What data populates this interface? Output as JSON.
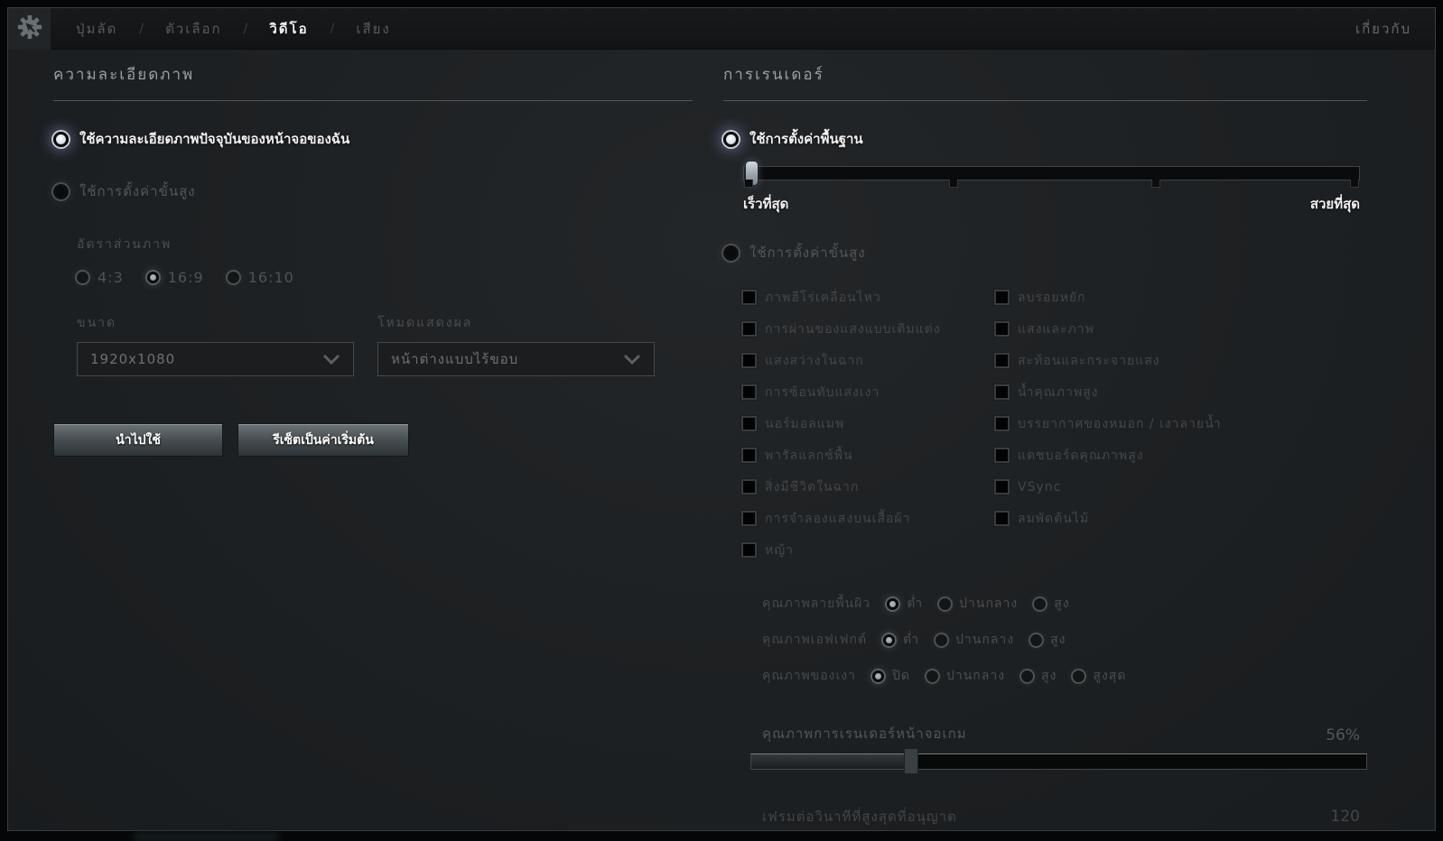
{
  "topbar": {
    "gear_icon": "gear-cursor-settings-icon",
    "separator": "/",
    "tabs": [
      {
        "label": "ปุ่มลัด",
        "active": false
      },
      {
        "label": "ตัวเลือก",
        "active": false
      },
      {
        "label": "วิดีโอ",
        "active": true
      },
      {
        "label": "เสียง",
        "active": false
      }
    ],
    "about_label": "เกี่ยวกับ"
  },
  "resolution": {
    "title": "ความละเอียดภาพ",
    "use_current": {
      "label": "ใช้ความละเอียดภาพปัจจุบันของหน้าจอของฉัน",
      "selected": true
    },
    "use_advanced": {
      "label": "ใช้การตั้งค่าขั้นสูง",
      "selected": false
    },
    "aspect": {
      "label": "อัตราส่วนภาพ",
      "options": [
        {
          "label": "4:3",
          "selected": false
        },
        {
          "label": "16:9",
          "selected": true
        },
        {
          "label": "16:10",
          "selected": false
        }
      ]
    },
    "size": {
      "label": "ขนาด",
      "value": "1920x1080"
    },
    "display_mode": {
      "label": "โหมดแสดงผล",
      "value": "หน้าต่างแบบไร้ขอบ"
    },
    "apply_label": "นำไปใช้",
    "reset_label": "รีเซ็ตเป็นค่าเริ่มต้น"
  },
  "rendering": {
    "title": "การเรนเดอร์",
    "use_basic": {
      "label": "ใช้การตั้งค่าพื้นฐาน",
      "selected": true
    },
    "basic_slider": {
      "left_label": "เร็วที่สุด",
      "right_label": "สวยที่สุด",
      "value_pct": 0,
      "ticks_pct": [
        0,
        34,
        67,
        100
      ]
    },
    "use_advanced": {
      "label": "ใช้การตั้งค่าขั้นสูง",
      "selected": false
    },
    "advanced_options": {
      "col1": [
        "ภาพฮีโร่เคลื่อนไหว",
        "การผ่านของแสงแบบเติมแต่ง",
        "แสงสว่างในฉาก",
        "การซ้อนทับแสงเงา",
        "นอร์มอลแมพ",
        "พารัลแลกซ์พื้น",
        "สิ่งมีชีวิตในฉาก",
        "การจำลองแสงบนเสื้อผ้า",
        "หญ้า"
      ],
      "col2": [
        "ลบรอยหยัก",
        "แสงและภาพ",
        "สะท้อนและกระจายแสง",
        "น้ำคุณภาพสูง",
        "บรรยากาศของหมอก / เงาลายน้ำ",
        "แดชบอร์ดคุณภาพสูง",
        "VSync",
        "ลมพัดต้นไม้"
      ],
      "all_checked": false
    },
    "quality_rows": [
      {
        "label": "คุณภาพลายพื้นผิว",
        "options": [
          "ต่ำ",
          "ปานกลาง",
          "สูง"
        ],
        "selected_index": 0
      },
      {
        "label": "คุณภาพเอฟเฟกต์",
        "options": [
          "ต่ำ",
          "ปานกลาง",
          "สูง"
        ],
        "selected_index": 0
      },
      {
        "label": "คุณภาพของเงา",
        "options": [
          "ปิด",
          "ปานกลาง",
          "สูง",
          "สูงสุด"
        ],
        "selected_index": 0
      }
    ],
    "render_quality": {
      "label": "คุณภาพการเรนเดอร์หน้าจอเกม",
      "value": "56%",
      "slider_pct": 26
    },
    "max_fps": {
      "label": "เฟรมต่อวินาทีที่สูงสุดที่อนุญาต",
      "value": "120"
    }
  },
  "colors": {
    "panel_bg": "#1d2022",
    "topbar_bg": "#141618",
    "text_bright": "#f2f2f2",
    "text_dim": "#53575a",
    "text_disabled": "#42474a",
    "selected_glow": "#a5afff",
    "slider_handle": "#9aa4ac"
  }
}
